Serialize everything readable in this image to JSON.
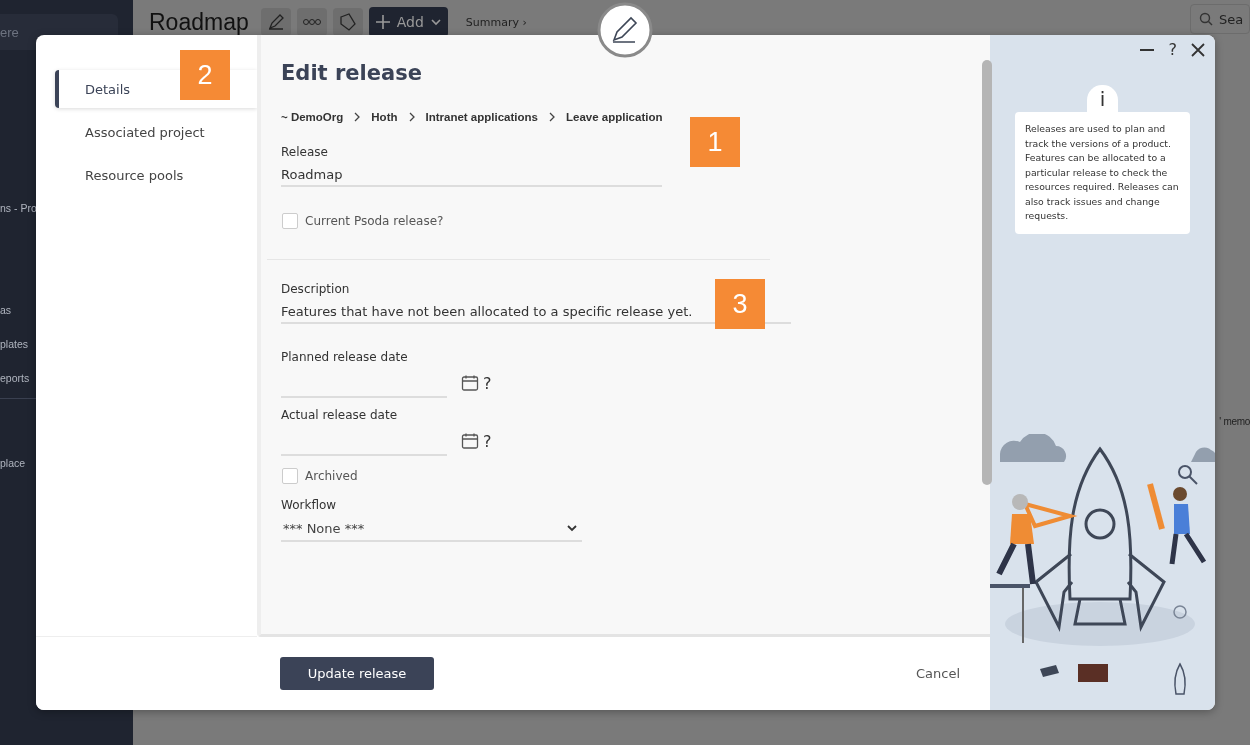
{
  "background": {
    "sidebar": {
      "search_text": "ere",
      "items": [
        "ns - Pro",
        "as",
        "plates",
        "eports",
        "place"
      ]
    },
    "page_title": "Roadmap",
    "add_button": "Add",
    "summary_link": "Summary ›",
    "search_text": "Sea",
    "side_text": "' memo"
  },
  "modal": {
    "nav": [
      {
        "label": "Details",
        "selected": true
      },
      {
        "label": "Associated project",
        "selected": false
      },
      {
        "label": "Resource pools",
        "selected": false
      }
    ],
    "title": "Edit release",
    "breadcrumb": [
      "~ DemoOrg",
      "Hoth",
      "Intranet applications",
      "Leave application"
    ],
    "sections": [
      [
        {
          "kind": "text",
          "label": "Release",
          "value": "Roadmap"
        },
        {
          "kind": "checkbox",
          "label": "Current Psoda release?",
          "checked": false
        }
      ],
      [
        {
          "kind": "text",
          "label": "Description",
          "value": "Features that have not been allocated to a specific release yet."
        },
        {
          "kind": "date",
          "label": "Planned release date",
          "help": "?"
        },
        {
          "kind": "date",
          "label": "Actual release date",
          "help": "?"
        },
        {
          "kind": "checkbox",
          "label": "Archived",
          "checked": false
        },
        {
          "kind": "select",
          "label": "Workflow",
          "value": "*** None ***"
        }
      ]
    ],
    "window_buttons": {
      "help": "?"
    },
    "info_icon": "i",
    "info_text": "Releases are used to plan and track the versions of a product. Features can be allocated to a particular release to check the resources required. Releases can also track issues and change requests.",
    "primary_button": "Update release",
    "cancel_button": "Cancel"
  },
  "callouts": [
    "1",
    "2",
    "3"
  ]
}
